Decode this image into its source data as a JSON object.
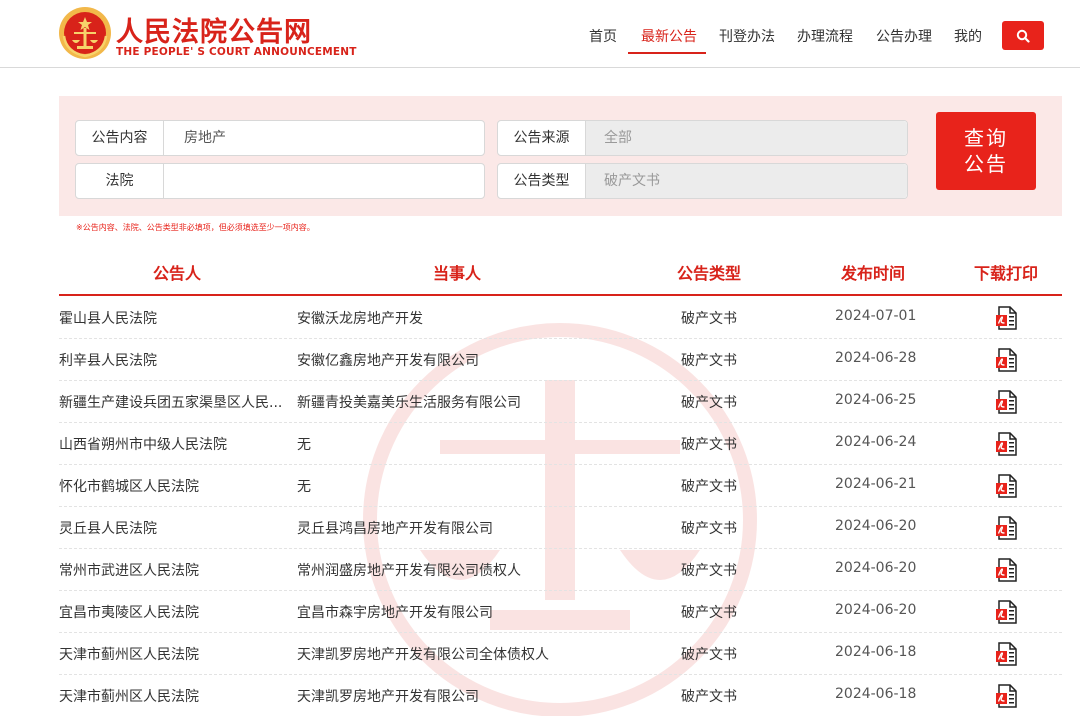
{
  "header": {
    "title": "人民法院公告网",
    "subtitle": "THE PEOPLE' S COURT ANNOUNCEMENT",
    "nav": [
      {
        "label": "首页",
        "active": false
      },
      {
        "label": "最新公告",
        "active": true
      },
      {
        "label": "刊登办法",
        "active": false
      },
      {
        "label": "办理流程",
        "active": false
      },
      {
        "label": "公告办理",
        "active": false
      },
      {
        "label": "我的",
        "active": false
      }
    ],
    "search_icon": "search-icon"
  },
  "query": {
    "content_label": "公告内容",
    "content_value": "房地产",
    "court_label": "法院",
    "court_value": "",
    "source_label": "公告来源",
    "source_value": "全部",
    "type_label": "公告类型",
    "type_value": "破产文书",
    "button_line1": "查询",
    "button_line2": "公告",
    "hint": "※公告内容、法院、公告类型非必填项，但必须填选至少一项内容。"
  },
  "table": {
    "headers": [
      "公告人",
      "当事人",
      "公告类型",
      "发布时间",
      "下载打印"
    ],
    "rows": [
      {
        "court": "霍山县人民法院",
        "party": "安徽沃龙房地产开发",
        "type": "破产文书",
        "date": "2024-07-01"
      },
      {
        "court": "利辛县人民法院",
        "party": "安徽亿鑫房地产开发有限公司",
        "type": "破产文书",
        "date": "2024-06-28"
      },
      {
        "court": "新疆生产建设兵团五家渠垦区人民...",
        "party": "新疆青投美嘉美乐生活服务有限公司",
        "type": "破产文书",
        "date": "2024-06-25"
      },
      {
        "court": "山西省朔州市中级人民法院",
        "party": "无",
        "type": "破产文书",
        "date": "2024-06-24"
      },
      {
        "court": "怀化市鹤城区人民法院",
        "party": "无",
        "type": "破产文书",
        "date": "2024-06-21"
      },
      {
        "court": "灵丘县人民法院",
        "party": "灵丘县鸿昌房地产开发有限公司",
        "type": "破产文书",
        "date": "2024-06-20"
      },
      {
        "court": "常州市武进区人民法院",
        "party": "常州润盛房地产开发有限公司债权人",
        "type": "破产文书",
        "date": "2024-06-20"
      },
      {
        "court": "宜昌市夷陵区人民法院",
        "party": "宜昌市森宇房地产开发有限公司",
        "type": "破产文书",
        "date": "2024-06-20"
      },
      {
        "court": "天津市蓟州区人民法院",
        "party": "天津凯罗房地产开发有限公司全体债权人",
        "type": "破产文书",
        "date": "2024-06-18"
      },
      {
        "court": "天津市蓟州区人民法院",
        "party": "天津凯罗房地产开发有限公司",
        "type": "破产文书",
        "date": "2024-06-18"
      }
    ]
  },
  "colors": {
    "brand": "#d8231a",
    "panel": "#fbe8e7"
  }
}
